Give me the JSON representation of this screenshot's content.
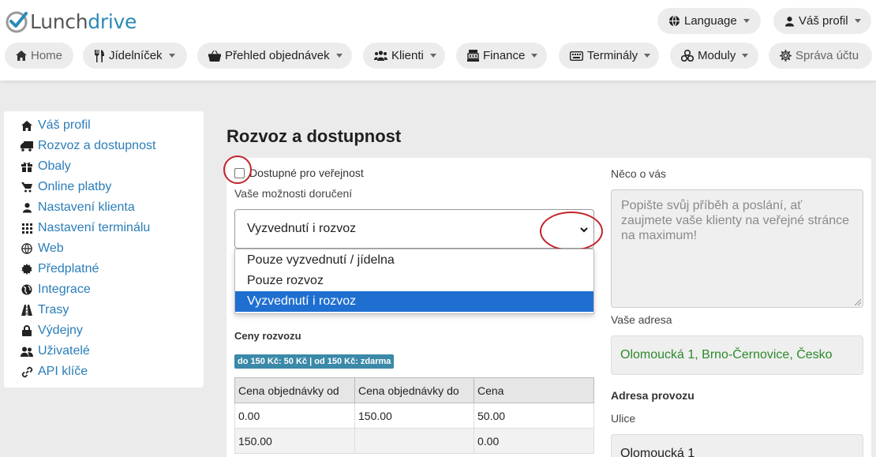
{
  "app": {
    "logo_text_a": "Lunch",
    "logo_text_b": "drive"
  },
  "header": {
    "language_label": "Language",
    "profile_label": "Váš profil"
  },
  "nav": {
    "home": "Home",
    "jidelnicek": "Jídelníček",
    "objednavky": "Přehled objednávek",
    "klienti": "Klienti",
    "finance": "Finance",
    "terminaly": "Terminály",
    "moduly": "Moduly",
    "sprava": "Správa účtu"
  },
  "sidebar": {
    "items": [
      {
        "label": "Váš profil",
        "icon": "home-icon"
      },
      {
        "label": "Rozvoz a dostupnost",
        "icon": "truck-icon"
      },
      {
        "label": "Obaly",
        "icon": "gift-icon"
      },
      {
        "label": "Online platby",
        "icon": "cart-icon"
      },
      {
        "label": "Nastavení klienta",
        "icon": "user-icon"
      },
      {
        "label": "Nastavení terminálu",
        "icon": "grid-icon"
      },
      {
        "label": "Web",
        "icon": "globe-icon"
      },
      {
        "label": "Předplatné",
        "icon": "badge-icon"
      },
      {
        "label": "Integrace",
        "icon": "earth-icon"
      },
      {
        "label": "Trasy",
        "icon": "road-icon"
      },
      {
        "label": "Výdejny",
        "icon": "lock-icon"
      },
      {
        "label": "Uživatelé",
        "icon": "users-icon"
      },
      {
        "label": "API klíče",
        "icon": "link-icon"
      }
    ]
  },
  "main": {
    "title": "Rozvoz a dostupnost",
    "public_checkbox_label": "Dostupné pro veřejnost",
    "public_checked": false,
    "delivery_label": "Vaše možnosti doručení",
    "delivery_selected": "Vyzvednutí i rozvoz",
    "delivery_options": [
      "Pouze vyzvednutí / jídelna",
      "Pouze rozvoz",
      "Vyzvednutí i rozvoz"
    ],
    "delivery_prices_heading": "Ceny rozvozu",
    "delivery_price_summary": "do 150 Kč: 50 Kč | od 150 Kč: zdarma",
    "price_table": {
      "headers": [
        "Cena objednávky od",
        "Cena objednávky do",
        "Cena"
      ],
      "rows": [
        [
          "0.00",
          "150.00",
          "50.00"
        ],
        [
          "150.00",
          "",
          "0.00"
        ]
      ]
    },
    "about_label": "Něco o vás",
    "about_placeholder": "Popište svůj příběh a poslání, ať zaujmete vaše klienty na veřejné stránce na maximum!",
    "address_label": "Vaše adresa",
    "address_value": "Olomoucká 1, Brno-Černovice, Česko",
    "provoz_heading": "Adresa provozu",
    "street_label": "Ulice",
    "street_value": "Olomoucká 1"
  },
  "colors": {
    "link": "#2a7db8",
    "selected_option": "#1f6fd1",
    "annotation": "#c0252b",
    "badge": "#3b89a8",
    "address_text": "#2c8a2c"
  }
}
